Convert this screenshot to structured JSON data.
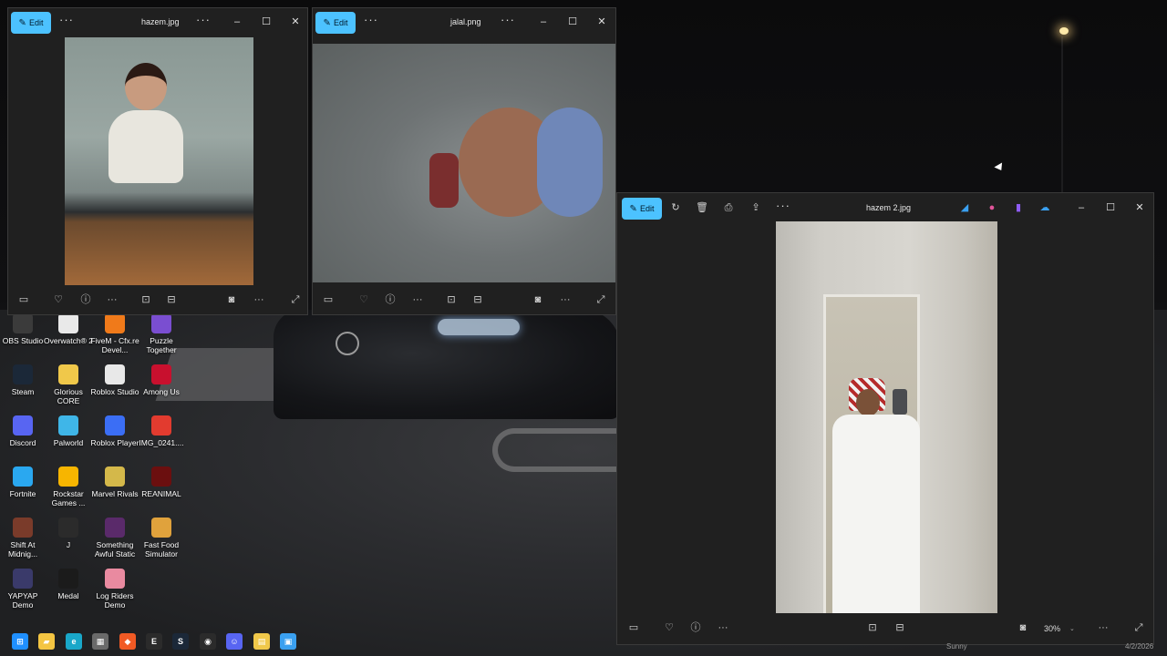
{
  "windows": {
    "hazem": {
      "title": "hazem.jpg",
      "edit_label": "Edit"
    },
    "jalal": {
      "title": "jalal.png",
      "edit_label": "Edit"
    },
    "hazem2": {
      "title": "hazem 2.jpg",
      "edit_label": "Edit",
      "zoom": "30%"
    }
  },
  "desktop_icons": [
    {
      "label": "OBS Studio",
      "color": "#3b3b3b"
    },
    {
      "label": "Overwatch® 2",
      "color": "#e9e9e9"
    },
    {
      "label": "FiveM - Cfx.re Devel...",
      "color": "#f07a1a"
    },
    {
      "label": "Puzzle Together",
      "color": "#7a4ed1"
    },
    {
      "label": "Steam",
      "color": "#1b2838"
    },
    {
      "label": "Glorious CORE",
      "color": "#f0c84a"
    },
    {
      "label": "Roblox Studio",
      "color": "#e8e8e8"
    },
    {
      "label": "Among Us",
      "color": "#c8102e"
    },
    {
      "label": "Discord",
      "color": "#5865f2"
    },
    {
      "label": "Palworld",
      "color": "#3fb6e8"
    },
    {
      "label": "Roblox Player",
      "color": "#3b6ef5"
    },
    {
      "label": "IMG_0241....",
      "color": "#e23b2f"
    },
    {
      "label": "Fortnite",
      "color": "#2aa8f0"
    },
    {
      "label": "Rockstar Games ...",
      "color": "#f7b500"
    },
    {
      "label": "Marvel Rivals",
      "color": "#d4b84a"
    },
    {
      "label": "REANIMAL",
      "color": "#6b0f0f"
    },
    {
      "label": "Shift At Midnig...",
      "color": "#7a3b2a"
    },
    {
      "label": "J",
      "color": "#2b2b2b"
    },
    {
      "label": "Something Awful Static",
      "color": "#5a2a6a"
    },
    {
      "label": "Fast Food Simulator",
      "color": "#e0a23c"
    },
    {
      "label": "YAPYAP Demo",
      "color": "#3a3a6a"
    },
    {
      "label": "Medal",
      "color": "#1b1b1b"
    },
    {
      "label": "Log Riders Demo",
      "color": "#e98aa0"
    }
  ],
  "taskbar": {
    "apps": [
      {
        "name": "windows-start-icon",
        "color": "#1f8fff",
        "glyph": "⊞"
      },
      {
        "name": "file-explorer-icon",
        "color": "#f4c542",
        "glyph": "▰"
      },
      {
        "name": "edge-icon",
        "color": "#19a7c9",
        "glyph": "e"
      },
      {
        "name": "store-icon",
        "color": "#6a6a6a",
        "glyph": "▦"
      },
      {
        "name": "brave-icon",
        "color": "#f15a24",
        "glyph": "◆"
      },
      {
        "name": "epic-games-icon",
        "color": "#2b2b2b",
        "glyph": "E"
      },
      {
        "name": "steam-taskbar-icon",
        "color": "#1b2838",
        "glyph": "S"
      },
      {
        "name": "obs-taskbar-icon",
        "color": "#2b2b2b",
        "glyph": "◉"
      },
      {
        "name": "discord-taskbar-icon",
        "color": "#5865f2",
        "glyph": "☺"
      },
      {
        "name": "notes-icon",
        "color": "#f0c84a",
        "glyph": "▤"
      },
      {
        "name": "photos-taskbar-icon",
        "color": "#3aa0f0",
        "glyph": "▣"
      }
    ],
    "weather": "Sunny",
    "date": "4/2/2026"
  }
}
